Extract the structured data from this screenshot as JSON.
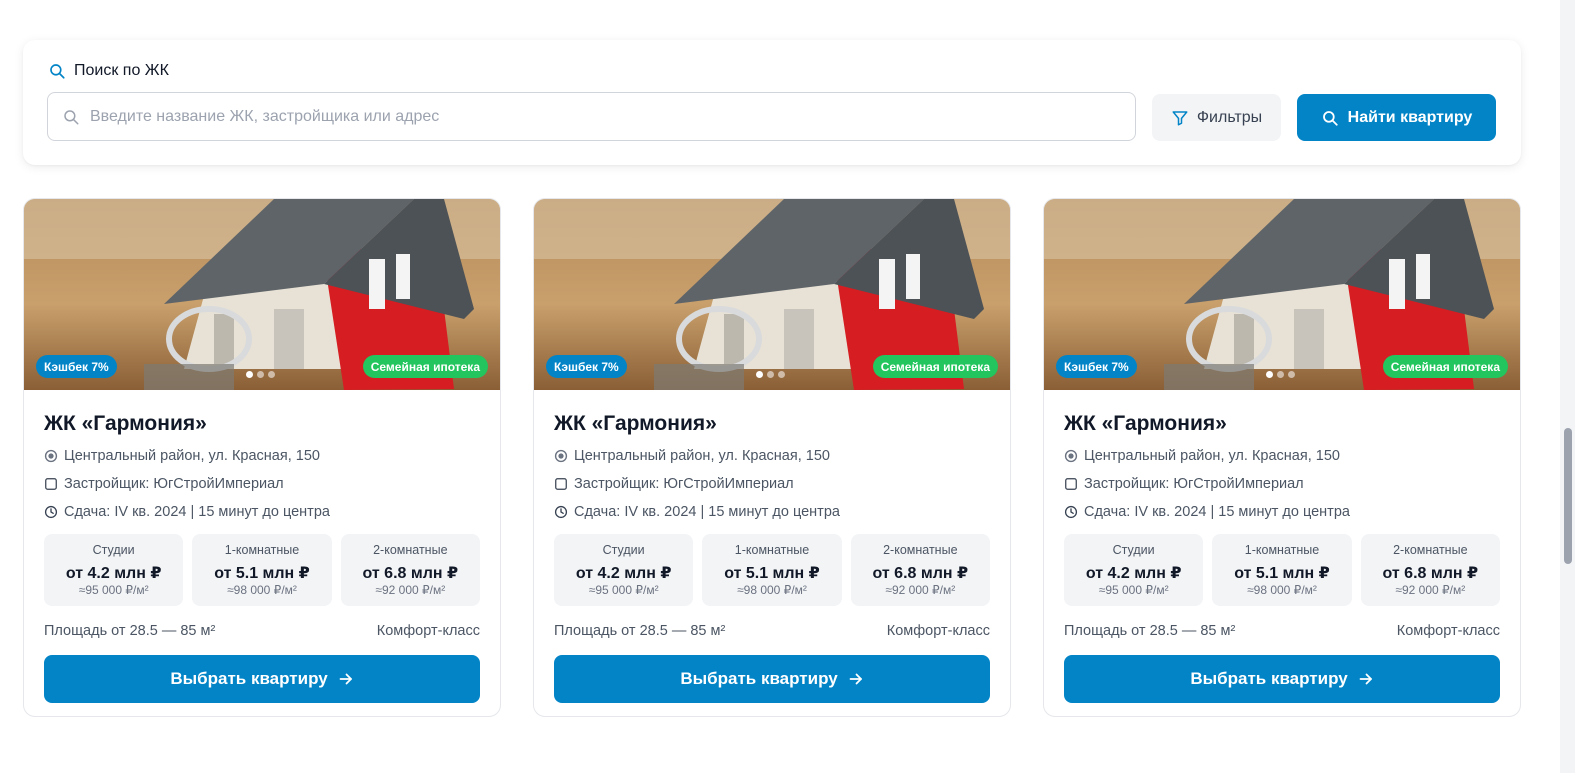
{
  "search": {
    "title": "Поиск по ЖК",
    "placeholder": "Введите название ЖК, застройщика или адрес",
    "filters_label": "Фильтры",
    "find_label": "Найти квартиру"
  },
  "cards": [
    {
      "badge_cashback": "Кэшбек 7%",
      "badge_mortgage": "Семейная ипотека",
      "title": "ЖК «Гармония»",
      "address": "Центральный район, ул. Красная, 150",
      "developer": "Застройщик: ЮгСтройИмпериал",
      "delivery": "Сдача: IV кв. 2024 | 15 минут до центра",
      "prices": [
        {
          "label": "Студии",
          "value": "от 4.2 млн ₽",
          "per_m2": "≈95 000 ₽/м²"
        },
        {
          "label": "1-комнатные",
          "value": "от 5.1 млн ₽",
          "per_m2": "≈98 000 ₽/м²"
        },
        {
          "label": "2-комнатные",
          "value": "от 6.8 млн ₽",
          "per_m2": "≈92 000 ₽/м²"
        }
      ],
      "area": "Площадь от 28.5 — 85 м²",
      "class": "Комфорт-класс",
      "button_label": "Выбрать квартиру"
    },
    {
      "badge_cashback": "Кэшбек 7%",
      "badge_mortgage": "Семейная ипотека",
      "title": "ЖК «Гармония»",
      "address": "Центральный район, ул. Красная, 150",
      "developer": "Застройщик: ЮгСтройИмпериал",
      "delivery": "Сдача: IV кв. 2024 | 15 минут до центра",
      "prices": [
        {
          "label": "Студии",
          "value": "от 4.2 млн ₽",
          "per_m2": "≈95 000 ₽/м²"
        },
        {
          "label": "1-комнатные",
          "value": "от 5.1 млн ₽",
          "per_m2": "≈98 000 ₽/м²"
        },
        {
          "label": "2-комнатные",
          "value": "от 6.8 млн ₽",
          "per_m2": "≈92 000 ₽/м²"
        }
      ],
      "area": "Площадь от 28.5 — 85 м²",
      "class": "Комфорт-класс",
      "button_label": "Выбрать квартиру"
    },
    {
      "badge_cashback": "Кэшбек 7%",
      "badge_mortgage": "Семейная ипотека",
      "title": "ЖК «Гармония»",
      "address": "Центральный район, ул. Красная, 150",
      "developer": "Застройщик: ЮгСтройИмпериал",
      "delivery": "Сдача: IV кв. 2024 | 15 минут до центра",
      "prices": [
        {
          "label": "Студии",
          "value": "от 4.2 млн ₽",
          "per_m2": "≈95 000 ₽/м²"
        },
        {
          "label": "1-комнатные",
          "value": "от 5.1 млн ₽",
          "per_m2": "≈98 000 ₽/м²"
        },
        {
          "label": "2-комнатные",
          "value": "от 6.8 млн ₽",
          "per_m2": "≈92 000 ₽/м²"
        }
      ],
      "area": "Площадь от 28.5 — 85 м²",
      "class": "Комфорт-класс",
      "button_label": "Выбрать квартиру"
    }
  ],
  "colors": {
    "accent": "#0284c7",
    "badge_green": "#22c55e"
  }
}
